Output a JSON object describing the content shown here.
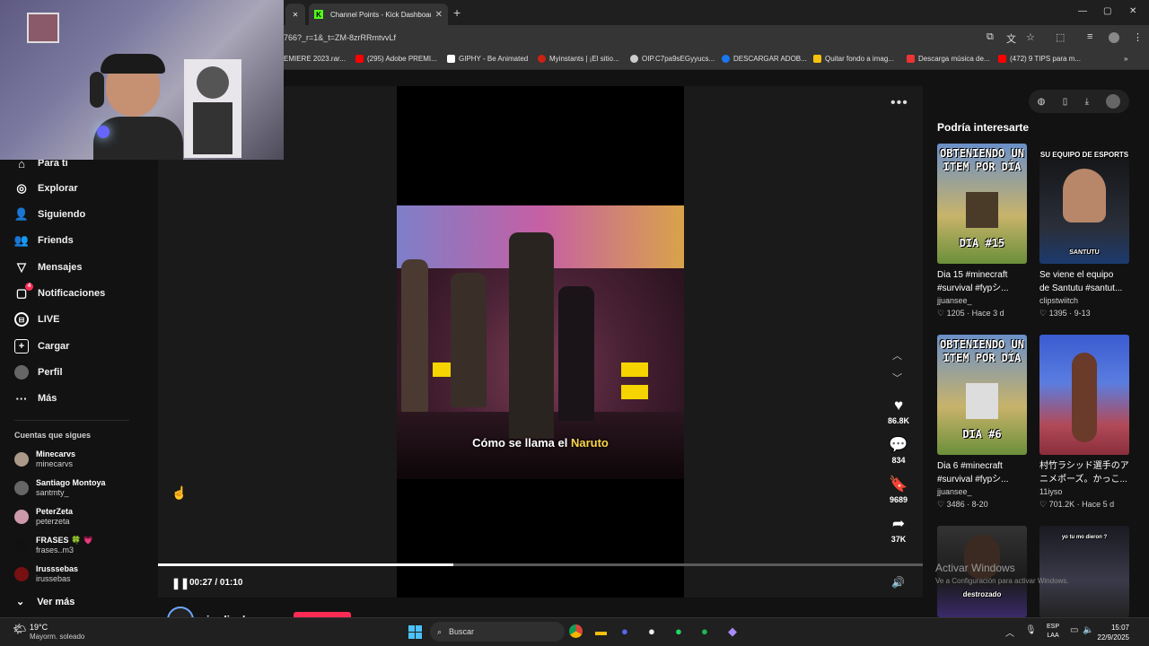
{
  "browser": {
    "tab_title": "Channel Points - Kick Dashboard",
    "url": "766?_r=1&_t=ZM-8zrRRmtvvLf",
    "bookmarks": [
      "EMIERE 2023.rar...",
      "(295) Adobe PREMI...",
      "GIPHY - Be Animated",
      "Myinstants | ¡El sitio...",
      "OIP.C7pa9sEGyyucs...",
      "DESCARGAR ADOB...",
      "Quitar fondo a imag...",
      "Descarga música de...",
      "(472) 9 TIPS para m..."
    ]
  },
  "sidebar": {
    "nav": [
      {
        "label": "Para ti",
        "icon": "home-icon"
      },
      {
        "label": "Explorar",
        "icon": "compass-icon"
      },
      {
        "label": "Siguiendo",
        "icon": "following-icon"
      },
      {
        "label": "Friends",
        "icon": "friends-icon"
      },
      {
        "label": "Mensajes",
        "icon": "messages-icon"
      },
      {
        "label": "Notificaciones",
        "icon": "notifications-icon",
        "badge": "4"
      },
      {
        "label": "LIVE",
        "icon": "live-icon"
      },
      {
        "label": "Cargar",
        "icon": "upload-icon"
      },
      {
        "label": "Perfil",
        "icon": "profile-icon"
      },
      {
        "label": "Más",
        "icon": "more-icon"
      }
    ],
    "following_title": "Cuentas que sigues",
    "accounts": [
      {
        "name": "Minecarvs",
        "handle": "minecarvs"
      },
      {
        "name": "Santiago Montoya",
        "handle": "santmty_"
      },
      {
        "name": "PeterZeta",
        "handle": "peterzeta"
      },
      {
        "name": "FRASES 🍀 💗",
        "handle": "frases..m3"
      },
      {
        "name": "Irusssebas",
        "handle": "irussebas"
      }
    ],
    "see_more": "Ver más"
  },
  "player": {
    "subtitle_pre": "Cómo se llama el ",
    "subtitle_hl": "Naruto",
    "likes": "86.8K",
    "comments": "834",
    "saves": "9689",
    "shares": "37K",
    "time": "00:27 / 01:10",
    "progress": 0.386,
    "author": "jordincho"
  },
  "recommendations": {
    "title": "Podría interesarte",
    "cards": [
      {
        "thumb_top": "OBTENIENDO UN ITEM POR DÍA",
        "thumb_bottom": "DIA #15",
        "title": "Dia 15 #minecraft",
        "title2": "#survival #fypシ...",
        "author": "jjuansee_",
        "likes": "1205",
        "date": "Hace 3 d"
      },
      {
        "thumb_top": "SU EQUIPO DE ESPORTS",
        "thumb_brand": "SANTUTU",
        "title": "Se viene el equipo",
        "title2": "de Santutu #santut...",
        "author": "clipstwiitch",
        "likes": "1395",
        "date": "9-13"
      },
      {
        "thumb_top": "OBTENIENDO UN ITEM POR DÍA",
        "thumb_bottom": "DIA #6",
        "title": "Dia 6 #minecraft",
        "title2": "#survival #fypシ...",
        "author": "jjuansee_",
        "likes": "3486",
        "date": "8-20"
      },
      {
        "title": "村竹ラシッド選手のア",
        "title2": "ニメポーズ。かっこ...",
        "author": "11iyso",
        "likes": "701.2K",
        "date": "Hace 5 d"
      },
      {
        "thumb_bottom": "destrozado"
      },
      {
        "thumb_top": "yo tu mo dieron ?"
      }
    ]
  },
  "windows_watermark": {
    "line1": "Activar Windows",
    "line2": "Ve a Configuración para activar Windows."
  },
  "taskbar": {
    "temp": "19°C",
    "weather": "Mayorm. soleado",
    "search_placeholder": "Buscar",
    "lang1": "ESP",
    "lang2": "LAA",
    "clock": "15:07",
    "date": "22/9/2025"
  },
  "colors": {
    "accent": "#fe2c55",
    "kick": "#53fc18",
    "highlight": "#f8d548"
  }
}
